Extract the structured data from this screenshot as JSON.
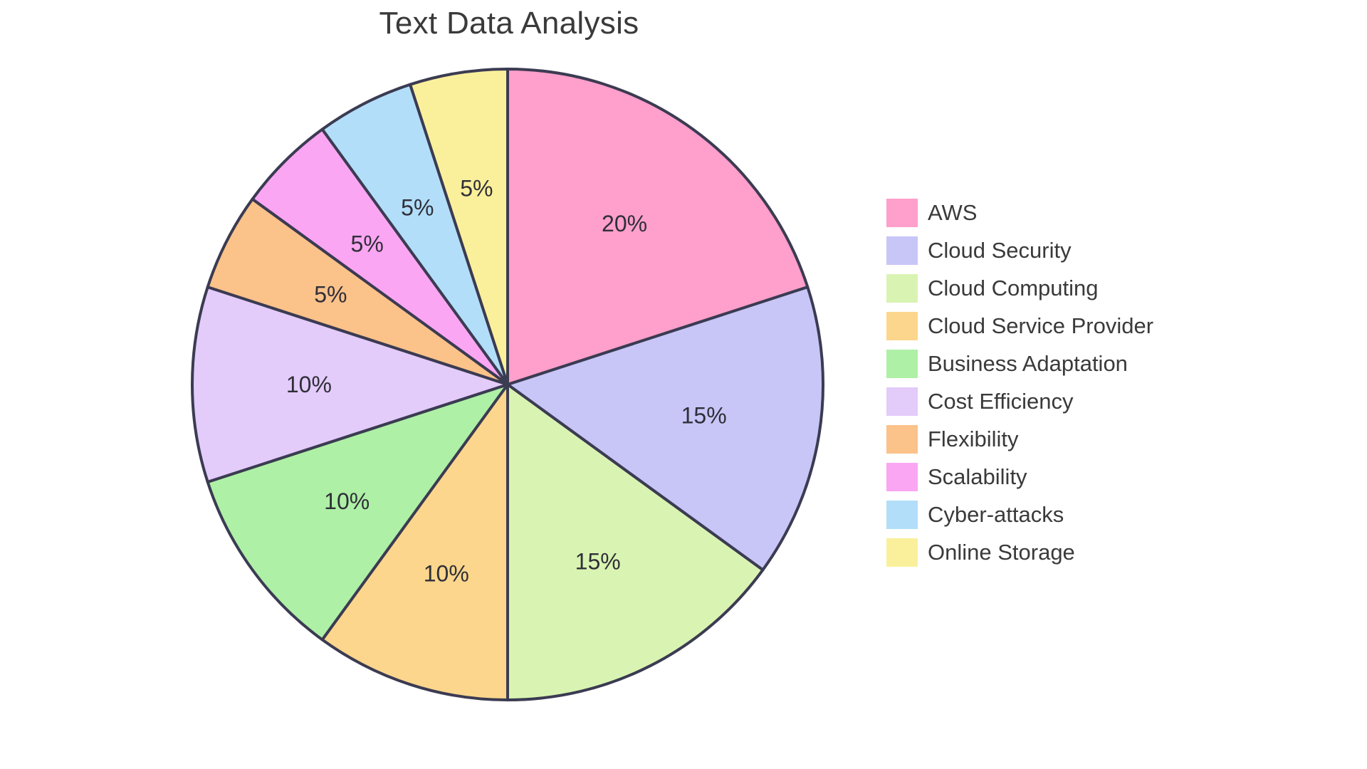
{
  "chart_data": {
    "type": "pie",
    "title": "Text Data Analysis",
    "xlabel": "",
    "ylabel": "",
    "legend_position": "right",
    "grid": false,
    "start_angle_deg": 90,
    "direction": "clockwise",
    "value_unit": "percent",
    "categories": [
      "AWS",
      "Cloud Security",
      "Cloud Computing",
      "Cloud Service Provider",
      "Business Adaptation",
      "Cost Efficiency",
      "Flexibility",
      "Scalability",
      "Cyber-attacks",
      "Online Storage"
    ],
    "values": [
      20,
      15,
      15,
      10,
      10,
      10,
      5,
      5,
      5,
      5
    ],
    "labels": [
      "20%",
      "15%",
      "15%",
      "10%",
      "10%",
      "10%",
      "5%",
      "5%",
      "5%",
      "5%"
    ],
    "colors": [
      "#FF9FCB",
      "#C8C6F7",
      "#D9F4B2",
      "#FCD68C",
      "#AEF0A6",
      "#E3CBFA",
      "#FBC28A",
      "#FBA6F3",
      "#B2DEF9",
      "#FAF09B"
    ],
    "slices": [
      {
        "label": "AWS",
        "value": 20,
        "display": "20%",
        "color": "#FF9FCB"
      },
      {
        "label": "Cloud Security",
        "value": 15,
        "display": "15%",
        "color": "#C8C6F7"
      },
      {
        "label": "Cloud Computing",
        "value": 15,
        "display": "15%",
        "color": "#D9F4B2"
      },
      {
        "label": "Cloud Service Provider",
        "value": 10,
        "display": "10%",
        "color": "#FCD68C"
      },
      {
        "label": "Business Adaptation",
        "value": 10,
        "display": "10%",
        "color": "#AEF0A6"
      },
      {
        "label": "Cost Efficiency",
        "value": 10,
        "display": "10%",
        "color": "#E3CBFA"
      },
      {
        "label": "Flexibility",
        "value": 5,
        "display": "5%",
        "color": "#FBC28A"
      },
      {
        "label": "Scalability",
        "value": 5,
        "display": "5%",
        "color": "#FBA6F3"
      },
      {
        "label": "Cyber-attacks",
        "value": 5,
        "display": "5%",
        "color": "#B2DEF9"
      },
      {
        "label": "Online Storage",
        "value": 5,
        "display": "5%",
        "color": "#FAF09B"
      }
    ],
    "stroke_color": "#3B3B52",
    "background_color": "#FFFFFF",
    "text_color": "#3A3A3A"
  }
}
